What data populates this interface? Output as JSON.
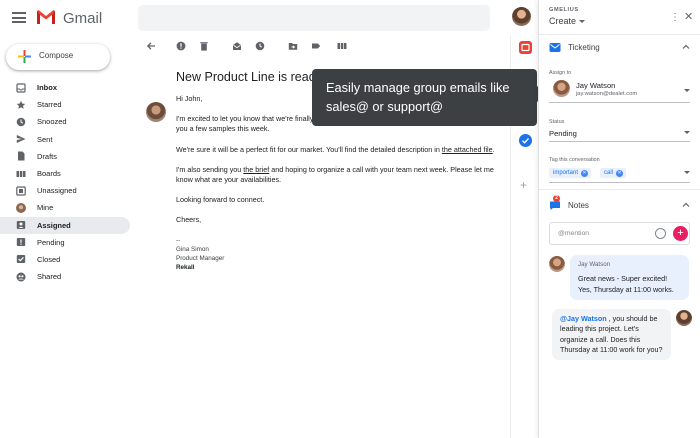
{
  "app": {
    "name": "Gmail"
  },
  "sidebar": {
    "compose_label": "Compose",
    "items": [
      {
        "label": "Inbox",
        "icon": "inbox-icon",
        "bold": true
      },
      {
        "label": "Starred",
        "icon": "star-icon"
      },
      {
        "label": "Snoozed",
        "icon": "clock-icon"
      },
      {
        "label": "Sent",
        "icon": "send-icon"
      },
      {
        "label": "Drafts",
        "icon": "draft-icon"
      },
      {
        "label": "Boards",
        "icon": "boards-icon"
      },
      {
        "label": "Unassigned",
        "icon": "unassigned-icon"
      },
      {
        "label": "Mine",
        "icon": "avatar-icon"
      },
      {
        "label": "Assigned",
        "icon": "assigned-icon",
        "active": true
      },
      {
        "label": "Pending",
        "icon": "pending-icon"
      },
      {
        "label": "Closed",
        "icon": "closed-icon"
      },
      {
        "label": "Shared",
        "icon": "shared-icon"
      }
    ]
  },
  "email": {
    "subject": "New Product Line is ready",
    "greeting": "Hi John,",
    "p1": "I'm excited to let you know that we're finally ready to launch our new product line! I'm going to send you a few samples this week.",
    "p2_before": "We're sure it will be a perfect fit for our market. You'll find the detailed description in ",
    "p2_link": "the attached file",
    "p2_after": ".",
    "p3_before": "I'm also sending you ",
    "p3_link": "the brief",
    "p3_after": " and hoping to organize a call with your team next week. Please let me know what are your availabilities.",
    "p4": "Looking forward to connect.",
    "closing": "Cheers,",
    "sig_dash": "--",
    "sig_name": "Gina Simon",
    "sig_title": "Product Manager",
    "sig_company": "Rekall"
  },
  "tooltip": {
    "text": "Easily manage group emails like sales@ or support@"
  },
  "panel": {
    "brand": "GMELIUS",
    "create_label": "Create",
    "ticketing": {
      "title": "Ticketing",
      "assign_label": "Assign to",
      "assignee_name": "Jay Watson",
      "assignee_email": "jay.watson@dealet.com",
      "status_label": "Status",
      "status_value": "Pending",
      "tags_label": "Tag this conversation",
      "tags": [
        "important",
        "call"
      ]
    },
    "notes": {
      "title": "Notes",
      "badge": "2",
      "placeholder": "@mention",
      "note1_author": "Jay Watson",
      "note1_text": "Great news - Super excited! Yes, Thursday at 11:00 works.",
      "note2_mention": "@Jay Watson",
      "note2_text": " , you should be leading this project. Let's organize a call. Does this Thursday at 11:00 work for you?"
    }
  },
  "colors": {
    "accent": "#1a73e8",
    "active_nav": "#e8eaed",
    "gmelius_red": "#ea4335",
    "pink": "#e91e63",
    "tooltip": "#3c4043"
  }
}
